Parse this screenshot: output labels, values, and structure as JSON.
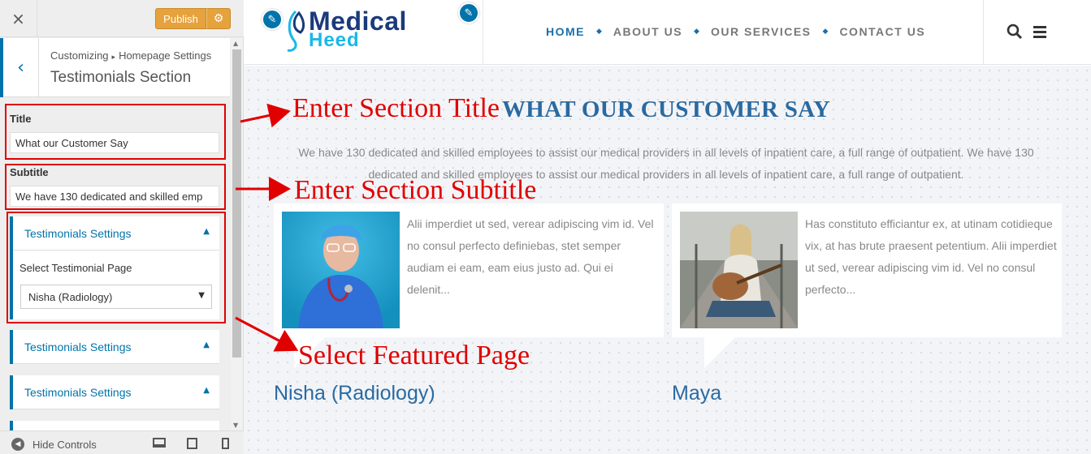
{
  "customizer": {
    "close_glyph": "×",
    "publish_label": "Publish",
    "gear_glyph": "⚙",
    "back_glyph": "‹",
    "breadcrumb": {
      "root": "Customizing",
      "separator": "▸",
      "parent": "Homepage Settings"
    },
    "section_title": "Testimonials Section",
    "title_label": "Title",
    "title_value": "What our Customer Say",
    "subtitle_label": "Subtitle",
    "subtitle_value": "We have 130 dedicated and skilled emp",
    "accordions": [
      {
        "title": "Testimonials Settings",
        "arrow": "▲",
        "select_label": "Select Testimonial Page",
        "select_value": "Nisha (Radiology)",
        "caret": "▼"
      },
      {
        "title": "Testimonials Settings",
        "arrow": "▲"
      },
      {
        "title": "Testimonials Settings",
        "arrow": "▲"
      }
    ],
    "scroll_up": "▲",
    "scroll_down": "▼",
    "hide_controls_label": "Hide Controls",
    "hide_icon_glyph": "◀"
  },
  "site": {
    "logo_top": "Medical",
    "logo_bottom": "Heed",
    "pencil_glyph": "✎",
    "nav": [
      "HOME",
      "ABOUT US",
      "OUR SERVICES",
      "CONTACT US"
    ],
    "nav_separator": "◆",
    "active_nav_index": 0,
    "section_heading": "WHAT OUR CUSTOMER SAY",
    "section_subtitle": "We have 130 dedicated and skilled employees to assist our medical providers in all levels of inpatient care, a full range of outpatient. We have 130 dedicated and skilled employees to assist our medical providers in all levels of inpatient care, a full range of outpatient.",
    "testimonials": [
      {
        "text": "Alii imperdiet ut sed, verear adipiscing vim id. Vel no consul perfecto definiebas, stet semper audiam ei eam, eam eius justo ad. Qui ei delenit...",
        "name": "Nisha (Radiology)"
      },
      {
        "text": "Has constituto efficiantur ex, at utinam cotidieque vix, at has brute praesent petentium. Alii imperdiet ut sed, verear adipiscing vim id. Vel no consul perfecto...",
        "name": "Maya"
      }
    ]
  },
  "annotations": {
    "title": "Enter Section Title",
    "subtitle": "Enter Section Subtitle",
    "featured": "Select Featured Page"
  },
  "colors": {
    "accent_blue": "#0073aa",
    "publish_orange": "#e6a23c",
    "annotation_red": "#e00000",
    "heading_blue": "#2a6aa1"
  }
}
